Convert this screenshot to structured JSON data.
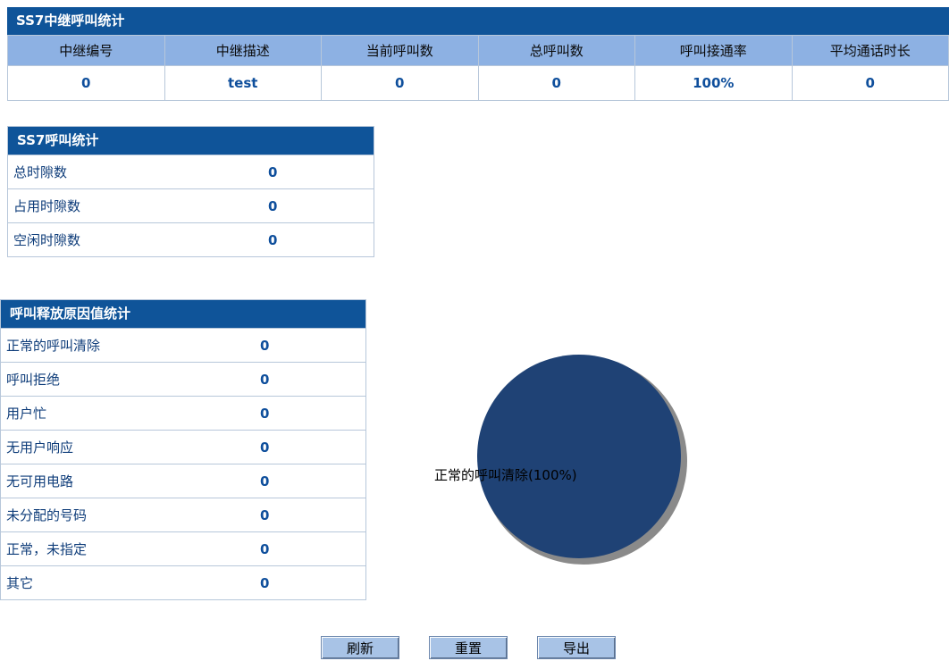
{
  "trunk": {
    "title": "SS7中继呼叫统计",
    "headers": [
      "中继编号",
      "中继描述",
      "当前呼叫数",
      "总呼叫数",
      "呼叫接通率",
      "平均通话时长"
    ],
    "row": [
      "0",
      "test",
      "0",
      "0",
      "100%",
      "0"
    ]
  },
  "ss7": {
    "title": "SS7呼叫统计",
    "rows": [
      {
        "label": "总时隙数",
        "value": "0"
      },
      {
        "label": "占用时隙数",
        "value": "0"
      },
      {
        "label": "空闲时隙数",
        "value": "0"
      }
    ]
  },
  "release": {
    "title": "呼叫释放原因值统计",
    "rows": [
      {
        "label": "正常的呼叫清除",
        "value": "0"
      },
      {
        "label": "呼叫拒绝",
        "value": "0"
      },
      {
        "label": "用户忙",
        "value": "0"
      },
      {
        "label": "无用户响应",
        "value": "0"
      },
      {
        "label": "无可用电路",
        "value": "0"
      },
      {
        "label": "未分配的号码",
        "value": "0"
      },
      {
        "label": "正常，未指定",
        "value": "0"
      },
      {
        "label": "其它",
        "value": "0"
      }
    ]
  },
  "chart_data": {
    "type": "pie",
    "slices": [
      {
        "label": "正常的呼叫清除(100%)",
        "value": 100,
        "color": "#1f4275"
      }
    ],
    "shadow_color": "#8a8a8a"
  },
  "buttons": {
    "refresh": "刷新",
    "reset": "重置",
    "export": "导出"
  }
}
